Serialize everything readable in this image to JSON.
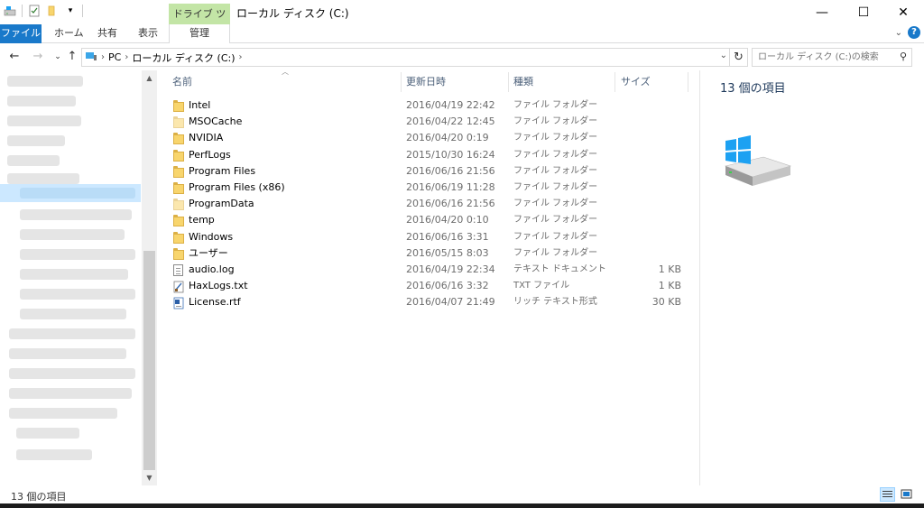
{
  "window": {
    "title": "ローカル ディスク (C:)",
    "context_tab_group": "ドライブ ツール",
    "minimize": "—",
    "maximize": "☐",
    "close": "✕"
  },
  "ribbon": {
    "file_tab": "ファイル",
    "tabs": [
      "ホーム",
      "共有",
      "表示"
    ],
    "context_tab": "管理"
  },
  "address": {
    "crumbs": [
      "PC",
      "ローカル ディスク (C:)"
    ],
    "search_placeholder": "ローカル ディスク (C:)の検索"
  },
  "columns": {
    "name": "名前",
    "date": "更新日時",
    "type": "種類",
    "size": "サイズ"
  },
  "files": [
    {
      "name": "Intel",
      "date": "2016/04/19 22:42",
      "type": "ファイル フォルダー",
      "size": "",
      "icon": "folder-icon"
    },
    {
      "name": "MSOCache",
      "date": "2016/04/22 12:45",
      "type": "ファイル フォルダー",
      "size": "",
      "icon": "folder-icon"
    },
    {
      "name": "NVIDIA",
      "date": "2016/04/20 0:19",
      "type": "ファイル フォルダー",
      "size": "",
      "icon": "folder-icon"
    },
    {
      "name": "PerfLogs",
      "date": "2015/10/30 16:24",
      "type": "ファイル フォルダー",
      "size": "",
      "icon": "folder-icon"
    },
    {
      "name": "Program Files",
      "date": "2016/06/16 21:56",
      "type": "ファイル フォルダー",
      "size": "",
      "icon": "folder-icon"
    },
    {
      "name": "Program Files (x86)",
      "date": "2016/06/19 11:28",
      "type": "ファイル フォルダー",
      "size": "",
      "icon": "folder-icon"
    },
    {
      "name": "ProgramData",
      "date": "2016/06/16 21:56",
      "type": "ファイル フォルダー",
      "size": "",
      "icon": "folder-icon"
    },
    {
      "name": "temp",
      "date": "2016/04/20 0:10",
      "type": "ファイル フォルダー",
      "size": "",
      "icon": "folder-icon"
    },
    {
      "name": "Windows",
      "date": "2016/06/16 3:31",
      "type": "ファイル フォルダー",
      "size": "",
      "icon": "folder-icon"
    },
    {
      "name": "ユーザー",
      "date": "2016/05/15 8:03",
      "type": "ファイル フォルダー",
      "size": "",
      "icon": "folder-icon"
    },
    {
      "name": "audio.log",
      "date": "2016/04/19 22:34",
      "type": "テキスト ドキュメント",
      "size": "1 KB",
      "icon": "text-document-icon"
    },
    {
      "name": "HaxLogs.txt",
      "date": "2016/06/16 3:32",
      "type": "TXT ファイル",
      "size": "1 KB",
      "icon": "txt-file-icon"
    },
    {
      "name": "License.rtf",
      "date": "2016/04/07 21:49",
      "type": "リッチ テキスト形式",
      "size": "30 KB",
      "icon": "rtf-document-icon"
    }
  ],
  "details": {
    "item_count": "13 個の項目"
  },
  "status": {
    "item_count": "13 個の項目"
  },
  "colors": {
    "file_tab": "#1979ca",
    "context_tab": "#c3e5a6",
    "selection": "#cce8ff",
    "header_text": "#4c607a"
  }
}
